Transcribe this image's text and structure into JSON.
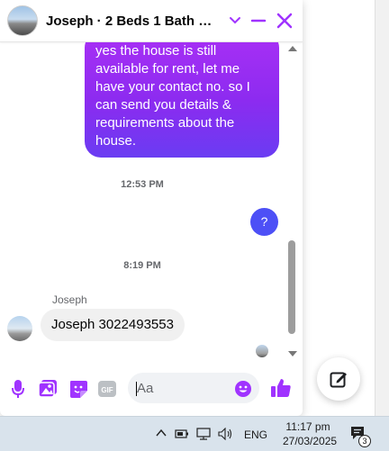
{
  "chat": {
    "title": "Joseph · 2 Beds 1 Bath Ho…",
    "outgoing_message": "yes the house is still available for rent, let me have your contact no. so I can send you details & requirements about the house.",
    "time_1": "12:53 PM",
    "question_reply": "?",
    "time_2": "8:19 PM",
    "sender_name": "Joseph",
    "incoming_message": "Joseph 3022493553",
    "accent_color": "#a033ff"
  },
  "composer": {
    "placeholder": "Aa",
    "icons": [
      "microphone-icon",
      "image-icon",
      "sticker-icon",
      "gif-icon",
      "emoji-icon",
      "thumbs-up-icon"
    ]
  },
  "taskbar": {
    "language": "ENG",
    "time": "11:17 pm",
    "date": "27/03/2025",
    "notification_count": "3"
  }
}
